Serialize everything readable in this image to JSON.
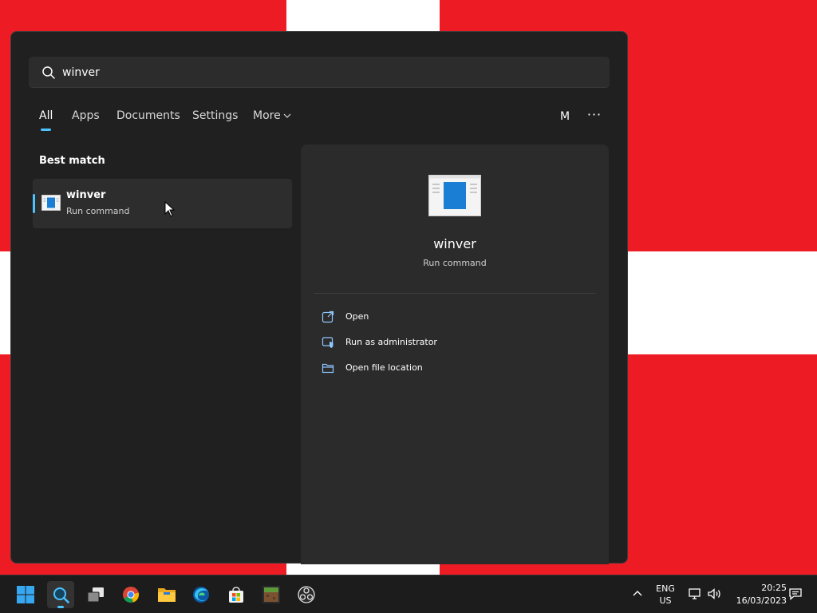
{
  "search": {
    "value": "winver",
    "icon": "search-icon"
  },
  "tabs": [
    {
      "label": "All",
      "active": true
    },
    {
      "label": "Apps"
    },
    {
      "label": "Documents"
    },
    {
      "label": "Settings"
    },
    {
      "label": "More"
    }
  ],
  "account": {
    "avatar_initial": "M",
    "more_label": "···"
  },
  "best_match": {
    "heading": "Best match",
    "item": {
      "title": "winver",
      "subtitle": "Run command",
      "icon": "run-command-icon"
    }
  },
  "preview": {
    "title": "winver",
    "subtitle": "Run command",
    "actions": [
      {
        "label": "Open",
        "icon": "open-external-icon"
      },
      {
        "label": "Run as administrator",
        "icon": "shield-admin-icon"
      },
      {
        "label": "Open file location",
        "icon": "folder-icon"
      }
    ]
  },
  "taskbar": {
    "apps": [
      {
        "name": "Start",
        "icon": "windows-start-icon"
      },
      {
        "name": "Search",
        "icon": "search-icon",
        "active": true
      },
      {
        "name": "Task View",
        "icon": "task-view-icon"
      },
      {
        "name": "Chrome",
        "icon": "chrome-icon"
      },
      {
        "name": "File Explorer",
        "icon": "file-explorer-icon"
      },
      {
        "name": "Edge",
        "icon": "edge-icon"
      },
      {
        "name": "Microsoft Store",
        "icon": "store-icon"
      },
      {
        "name": "Minecraft",
        "icon": "minecraft-icon"
      },
      {
        "name": "OBS",
        "icon": "obs-icon"
      }
    ],
    "tray": {
      "lang_top": "ENG",
      "lang_bottom": "US",
      "time": "20:25",
      "date": "16/03/2023"
    }
  },
  "colors": {
    "flag_red": "#ed1c24",
    "flag_white": "#ffffff",
    "panel_bg": "#202020",
    "accent": "#4cc2ff"
  }
}
